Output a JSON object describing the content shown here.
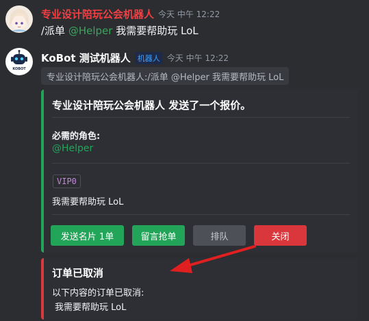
{
  "message1": {
    "username": "专业设计陪玩公会机器人",
    "timestamp": "今天 中午 12:22",
    "command": "/派单",
    "mention": "@Helper",
    "text": "我需要帮助玩 LoL"
  },
  "message2": {
    "username": "KoBot 测试机器人",
    "badge": "机器人",
    "timestamp": "今天 中午 12:22",
    "reply_text": "专业设计陪玩公会机器人:/派单 @Helper 我需要帮助玩 LoL",
    "avatar_label": "KOBOT",
    "embed": {
      "title": "专业设计陪玩公会机器人 发送了一个报价。",
      "field_name": "必需的角色:",
      "field_value": "@Helper",
      "tag": "VIP0",
      "description": "我需要帮助玩 LoL",
      "buttons": {
        "send_card": "发送名片 1单",
        "leave_message": "留言抢单",
        "queue": "排队",
        "close": "关闭"
      }
    },
    "embed2": {
      "title": "订单已取消",
      "line1": "以下内容的订单已取消:",
      "line2": "我需要帮助玩 LoL"
    }
  },
  "colors": {
    "background": "#2b2d31",
    "embed_bg": "#2e2f35",
    "green": "#23a559",
    "red": "#da373c",
    "username_red": "#f23f43",
    "arrow": "#e02020"
  },
  "icons": [
    "user-avatar-icon",
    "kobot-avatar-icon",
    "arrow-annotation-icon"
  ]
}
